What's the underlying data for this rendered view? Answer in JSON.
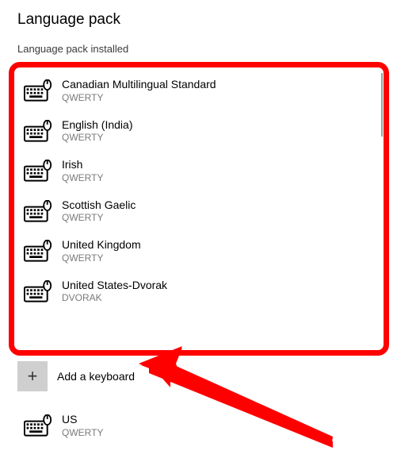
{
  "header": {
    "title": "Language pack",
    "status": "Language pack installed"
  },
  "keyboards": [
    {
      "name": "Canadian Multilingual Standard",
      "layout": "QWERTY"
    },
    {
      "name": "English (India)",
      "layout": "QWERTY"
    },
    {
      "name": "Irish",
      "layout": "QWERTY"
    },
    {
      "name": "Scottish Gaelic",
      "layout": "QWERTY"
    },
    {
      "name": "United Kingdom",
      "layout": "QWERTY"
    },
    {
      "name": "United States-Dvorak",
      "layout": "DVORAK"
    }
  ],
  "add": {
    "label": "Add a keyboard",
    "glyph": "+"
  },
  "installed": {
    "name": "US",
    "layout": "QWERTY"
  },
  "annotation": {
    "highlight": "keyboard-selection-list",
    "arrow_target": "add-keyboard-button",
    "color": "#ff0000"
  }
}
